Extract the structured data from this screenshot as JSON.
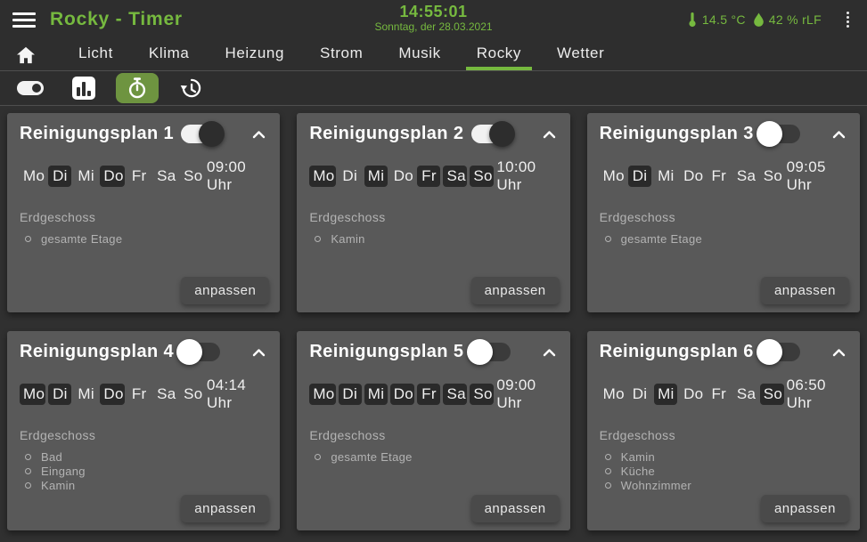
{
  "colors": {
    "accent": "#76b93f",
    "active_icon_bg": "#6e9440"
  },
  "header": {
    "title": "Rocky - Timer",
    "time": "14:55:01",
    "date": "Sonntag, der 28.03.2021",
    "temperature": "14.5 °C",
    "humidity": "42 % rLF"
  },
  "nav": {
    "tabs": [
      {
        "label": "Licht",
        "active": false
      },
      {
        "label": "Klima",
        "active": false
      },
      {
        "label": "Heizung",
        "active": false
      },
      {
        "label": "Strom",
        "active": false
      },
      {
        "label": "Musik",
        "active": false
      },
      {
        "label": "Rocky",
        "active": true
      },
      {
        "label": "Wetter",
        "active": false
      }
    ]
  },
  "toolbar": {
    "icons": [
      {
        "name": "switches-icon",
        "active": false
      },
      {
        "name": "chart-icon",
        "active": false
      },
      {
        "name": "timer-icon",
        "active": true
      },
      {
        "name": "history-icon",
        "active": false
      }
    ]
  },
  "cards": [
    {
      "title": "Reinigungsplan 1",
      "enabled": true,
      "time": "09:00 Uhr",
      "floor": "Erdgeschoss",
      "items": [
        "gesamte Etage"
      ],
      "button_label": "anpassen",
      "days": [
        {
          "label": "Mo",
          "active": false
        },
        {
          "label": "Di",
          "active": true
        },
        {
          "label": "Mi",
          "active": false
        },
        {
          "label": "Do",
          "active": true
        },
        {
          "label": "Fr",
          "active": false
        },
        {
          "label": "Sa",
          "active": false
        },
        {
          "label": "So",
          "active": false
        }
      ]
    },
    {
      "title": "Reinigungsplan 2",
      "enabled": true,
      "time": "10:00 Uhr",
      "floor": "Erdgeschoss",
      "items": [
        "Kamin"
      ],
      "button_label": "anpassen",
      "days": [
        {
          "label": "Mo",
          "active": true
        },
        {
          "label": "Di",
          "active": false
        },
        {
          "label": "Mi",
          "active": true
        },
        {
          "label": "Do",
          "active": false
        },
        {
          "label": "Fr",
          "active": true
        },
        {
          "label": "Sa",
          "active": true
        },
        {
          "label": "So",
          "active": true
        }
      ]
    },
    {
      "title": "Reinigungsplan 3",
      "enabled": false,
      "time": "09:05 Uhr",
      "floor": "Erdgeschoss",
      "items": [
        "gesamte Etage"
      ],
      "button_label": "anpassen",
      "days": [
        {
          "label": "Mo",
          "active": false
        },
        {
          "label": "Di",
          "active": true
        },
        {
          "label": "Mi",
          "active": false
        },
        {
          "label": "Do",
          "active": false
        },
        {
          "label": "Fr",
          "active": false
        },
        {
          "label": "Sa",
          "active": false
        },
        {
          "label": "So",
          "active": false
        }
      ]
    },
    {
      "title": "Reinigungsplan 4",
      "enabled": false,
      "time": "04:14 Uhr",
      "floor": "Erdgeschoss",
      "items": [
        "Bad",
        "Eingang",
        "Kamin"
      ],
      "button_label": "anpassen",
      "days": [
        {
          "label": "Mo",
          "active": true
        },
        {
          "label": "Di",
          "active": true
        },
        {
          "label": "Mi",
          "active": false
        },
        {
          "label": "Do",
          "active": true
        },
        {
          "label": "Fr",
          "active": false
        },
        {
          "label": "Sa",
          "active": false
        },
        {
          "label": "So",
          "active": false
        }
      ]
    },
    {
      "title": "Reinigungsplan 5",
      "enabled": false,
      "time": "09:00 Uhr",
      "floor": "Erdgeschoss",
      "items": [
        "gesamte Etage"
      ],
      "button_label": "anpassen",
      "days": [
        {
          "label": "Mo",
          "active": true
        },
        {
          "label": "Di",
          "active": true
        },
        {
          "label": "Mi",
          "active": true
        },
        {
          "label": "Do",
          "active": true
        },
        {
          "label": "Fr",
          "active": true
        },
        {
          "label": "Sa",
          "active": true
        },
        {
          "label": "So",
          "active": true
        }
      ]
    },
    {
      "title": "Reinigungsplan 6",
      "enabled": false,
      "time": "06:50 Uhr",
      "floor": "Erdgeschoss",
      "items": [
        "Kamin",
        "Küche",
        "Wohnzimmer"
      ],
      "button_label": "anpassen",
      "days": [
        {
          "label": "Mo",
          "active": false
        },
        {
          "label": "Di",
          "active": false
        },
        {
          "label": "Mi",
          "active": true
        },
        {
          "label": "Do",
          "active": false
        },
        {
          "label": "Fr",
          "active": false
        },
        {
          "label": "Sa",
          "active": false
        },
        {
          "label": "So",
          "active": true
        }
      ]
    }
  ]
}
